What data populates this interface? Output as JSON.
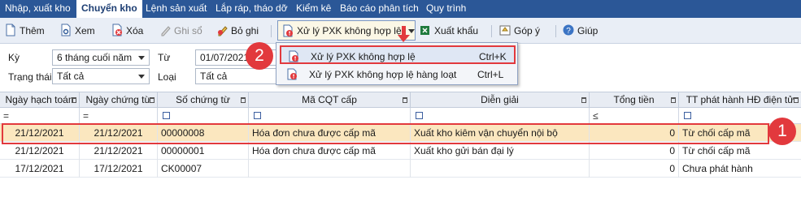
{
  "menu": {
    "items": [
      "Nhập, xuất kho",
      "Chuyển kho",
      "Lệnh sản xuất",
      "Lắp ráp, tháo dỡ",
      "Kiểm kê",
      "Báo cáo phân tích",
      "Quy trình"
    ],
    "active": "Chuyển kho"
  },
  "toolbar": {
    "them": "Thêm",
    "xem": "Xem",
    "xoa": "Xóa",
    "ghi_so": "Ghi sổ",
    "bo_ghi": "Bỏ ghi",
    "xu_ly": "Xử lý PXK không hợp lệ",
    "xuat_khau": "Xuất khẩu",
    "gop_y": "Góp ý",
    "giup": "Giúp"
  },
  "filters": {
    "ky_label": "Kỳ",
    "ky_value": "6 tháng cuối năm",
    "tu_label": "Từ",
    "tu_value": "01/07/2021",
    "trang_thai_label": "Trạng thái",
    "trang_thai_value": "Tất cả",
    "loai_label": "Loại",
    "loai_value": "Tất cả"
  },
  "dropdown_menu": {
    "items": [
      {
        "label": "Xử lý PXK không hợp lệ",
        "shortcut": "Ctrl+K"
      },
      {
        "label": "Xử lý PXK không hợp lệ hàng loạt",
        "shortcut": "Ctrl+L"
      }
    ]
  },
  "grid": {
    "columns": [
      "Ngày hạch toán",
      "Ngày chứng từ",
      "Số chứng từ",
      "Mã CQT cấp",
      "Diễn giải",
      "Tổng tiền",
      "TT phát hành HĐ điện tử"
    ],
    "filter_ops": [
      "=",
      "=",
      "",
      "",
      "",
      "≤",
      ""
    ],
    "rows": [
      [
        "21/12/2021",
        "21/12/2021",
        "00000008",
        "Hóa đơn chưa được cấp mã",
        "Xuất kho kiêm vận chuyển nội bộ",
        "0",
        "Từ chối cấp mã"
      ],
      [
        "21/12/2021",
        "21/12/2021",
        "00000001",
        "Hóa đơn chưa được cấp mã",
        "Xuất kho gửi bán đại lý",
        "0",
        "Từ chối cấp mã"
      ],
      [
        "17/12/2021",
        "17/12/2021",
        "CK00007",
        "",
        "",
        "0",
        "Chưa phát hành"
      ]
    ]
  },
  "callouts": {
    "one": "1",
    "two": "2"
  },
  "colors": {
    "menubar": "#2b5797",
    "highlight_red": "#e2393d",
    "selected_row": "#fbe7bf",
    "toolbar_bg": "#e9eef6"
  }
}
